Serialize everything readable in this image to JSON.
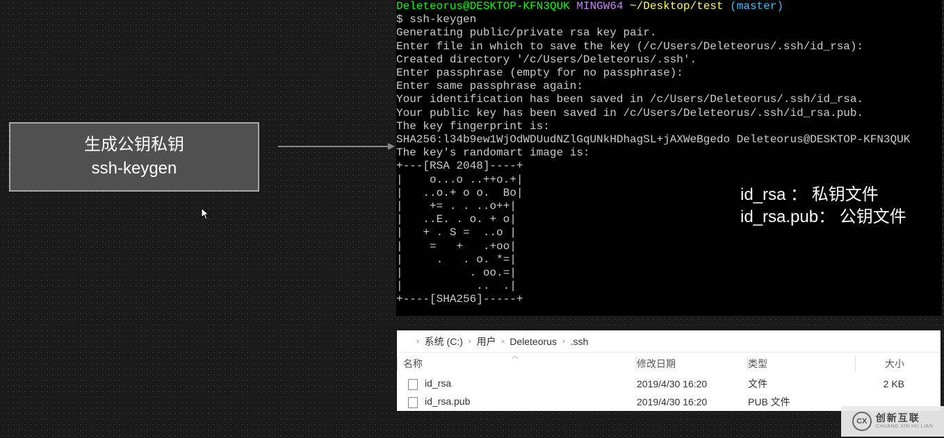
{
  "label": {
    "line1": "生成公钥私钥",
    "line2": "ssh-keygen"
  },
  "terminal": {
    "prompt": {
      "user": "Deleteorus@DESKTOP-KFN3QUK",
      "shell": "MINGW64",
      "path": "~/Desktop/test",
      "branch": "(master)"
    },
    "cmd": "$ ssh-keygen",
    "lines": [
      "Generating public/private rsa key pair.",
      "Enter file in which to save the key (/c/Users/Deleteorus/.ssh/id_rsa):",
      "Created directory '/c/Users/Deleteorus/.ssh'.",
      "Enter passphrase (empty for no passphrase):",
      "Enter same passphrase again:",
      "Your identification has been saved in /c/Users/Deleteorus/.ssh/id_rsa.",
      "Your public key has been saved in /c/Users/Deleteorus/.ssh/id_rsa.pub.",
      "The key fingerprint is:",
      "SHA256:l34b9ew1WjOdWDUudNZlGqUNkHDhagSL+jAXWeBgedo Deleteorus@DESKTOP-KFN3QUK",
      "The key's randomart image is:",
      "+---[RSA 2048]----+",
      "|    o...o ..++o.+|",
      "|   ..o.+ o o.  Bo|",
      "|    += . . ..o++|",
      "|   ..E. . o. + o|",
      "|   + . S =  ..o |",
      "|    =   +   .+oo|",
      "|     .   . o. *=|",
      "|          . oo.=|",
      "|           ..  .|",
      "+----[SHA256]-----+"
    ]
  },
  "annotation": {
    "line1": "id_rsa ：      私钥文件",
    "line2": "id_rsa.pub： 公钥文件"
  },
  "explorer": {
    "breadcrumb": [
      "系统 (C:)",
      "用户",
      "Deleteorus",
      ".ssh"
    ],
    "headers": {
      "name": "名称",
      "date": "修改日期",
      "type": "类型",
      "size": "大小"
    },
    "rows": [
      {
        "name": "id_rsa",
        "date": "2019/4/30 16:20",
        "type": "文件",
        "size": "2 KB"
      },
      {
        "name": "id_rsa.pub",
        "date": "2019/4/30 16:20",
        "type": "PUB 文件",
        "size": ""
      }
    ]
  },
  "logo": {
    "mark": "CX",
    "cn": "创新互联",
    "en": "CHUANG XIN HU LIAN"
  }
}
